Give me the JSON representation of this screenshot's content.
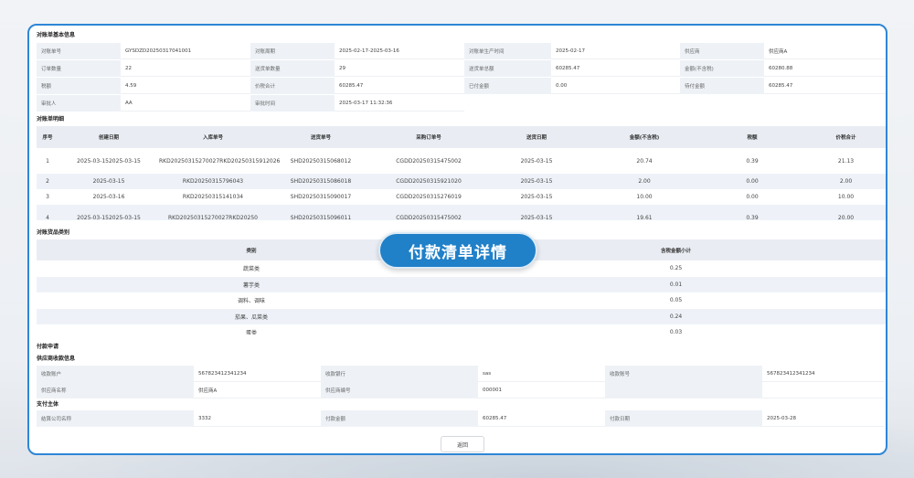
{
  "basic": {
    "title": "对账单基本信息",
    "rows": [
      [
        "对账单号",
        "GYSDZD20250317041001",
        "对账周期",
        "2025-02-17-2025-03-16",
        "对账单生产时间",
        "2025-02-17",
        "供应商",
        "供应商A"
      ],
      [
        "订单数量",
        "22",
        "送货单数量",
        "29",
        "送货单总额",
        "60285.47",
        "金额(不含税)",
        "60280.88"
      ],
      [
        "税额",
        "4.59",
        "价税合计",
        "60285.47",
        "已付金额",
        "0.00",
        "待付金额",
        "60285.47"
      ],
      [
        "审批人",
        "AA",
        "审批时间",
        "2025-03-17 11:32:36",
        "",
        "",
        "",
        ""
      ]
    ]
  },
  "detail": {
    "title": "对账单明细",
    "headers": [
      "序号",
      "创建日期",
      "入库单号",
      "送货单号",
      "采购订单号",
      "送货日期",
      "金额(不含税)",
      "税额",
      "价税合计"
    ],
    "rows": [
      [
        "1",
        "2025-03-152025-03-15",
        "RKD20250315270027RKD20250315912026",
        "SHD20250315068012",
        "CGDD20250315475002",
        "2025-03-15",
        "20.74",
        "0.39",
        "21.13"
      ],
      [
        "2",
        "2025-03-15",
        "RKD20250315796043",
        "SHD20250315086018",
        "CGDD20250315921020",
        "2025-03-15",
        "2.00",
        "0.00",
        "2.00"
      ],
      [
        "3",
        "2025-03-16",
        "RKD20250315141034",
        "SHD20250315090017",
        "CGDD20250315276019",
        "2025-03-15",
        "10.00",
        "0.00",
        "10.00"
      ],
      [
        "4",
        "2025-03-152025-03-15",
        "RKD20250315270027RKD20250",
        "SHD20250315096011",
        "CGDD20250315475002",
        "2025-03-15",
        "19.61",
        "0.39",
        "20.00"
      ]
    ]
  },
  "category": {
    "title": "对账货品类别",
    "headers": [
      "类别",
      "含税金额小计"
    ],
    "rows": [
      [
        "蔬菜类",
        "0.25"
      ],
      [
        "薯芋类",
        "0.01"
      ],
      [
        "调料、调味",
        "0.05"
      ],
      [
        "茄果、瓜菜类",
        "0.24"
      ],
      [
        "蛋类",
        "0.03"
      ]
    ]
  },
  "payment": {
    "title": "付款申请",
    "supplier_title": "供应商收款信息",
    "supplier_rows": [
      [
        "收款账户",
        "567823412341234",
        "收款银行",
        "sas",
        "收款账号",
        "567823412341234"
      ],
      [
        "供应商名称",
        "供应商A",
        "供应商编号",
        "000001",
        "",
        ""
      ]
    ],
    "payer_title": "支付主体",
    "payer_rows": [
      [
        "结算公司名称",
        "3332",
        "付款金额",
        "60285.47",
        "付款日期",
        "2025-03-28"
      ]
    ]
  },
  "back_label": "返回",
  "badge_label": "付款清单详情",
  "colors": {
    "accent": "#2e86d6",
    "badge": "#2080c8",
    "header_bg": "#e9edf3",
    "stripe": "#eef2f8"
  }
}
